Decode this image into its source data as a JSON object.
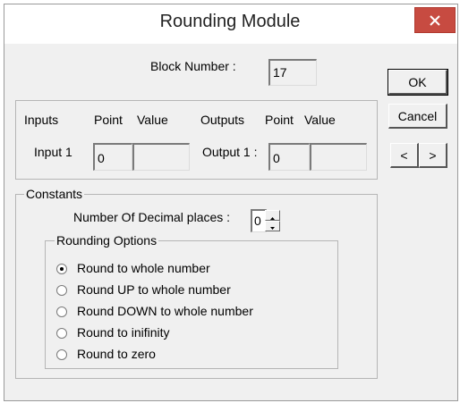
{
  "window": {
    "title": "Rounding Module",
    "close_icon": "close-icon"
  },
  "block": {
    "label": "Block Number :",
    "value": "17"
  },
  "buttons": {
    "ok": "OK",
    "cancel": "Cancel",
    "prev": "<",
    "next": ">"
  },
  "io": {
    "headers": {
      "inputs": "Inputs",
      "point1": "Point",
      "value1": "Value",
      "outputs": "Outputs",
      "point2": "Point",
      "value2": "Value"
    },
    "input1": {
      "label": "Input 1",
      "point": "0",
      "value": ""
    },
    "output1": {
      "label": "Output 1 :",
      "point": "0",
      "value": ""
    }
  },
  "constants": {
    "title": "Constants",
    "decimal_label": "Number Of Decimal places :",
    "decimal_value": "0"
  },
  "rounding": {
    "title": "Rounding Options",
    "options": [
      {
        "label": "Round to whole number",
        "selected": true
      },
      {
        "label": "Round UP to whole number",
        "selected": false
      },
      {
        "label": "Round DOWN to whole number",
        "selected": false
      },
      {
        "label": "Round to inifinity",
        "selected": false
      },
      {
        "label": "Round to zero",
        "selected": false
      }
    ]
  },
  "colors": {
    "close_bg": "#c74b41",
    "dialog_bg": "#f0f0f0"
  }
}
